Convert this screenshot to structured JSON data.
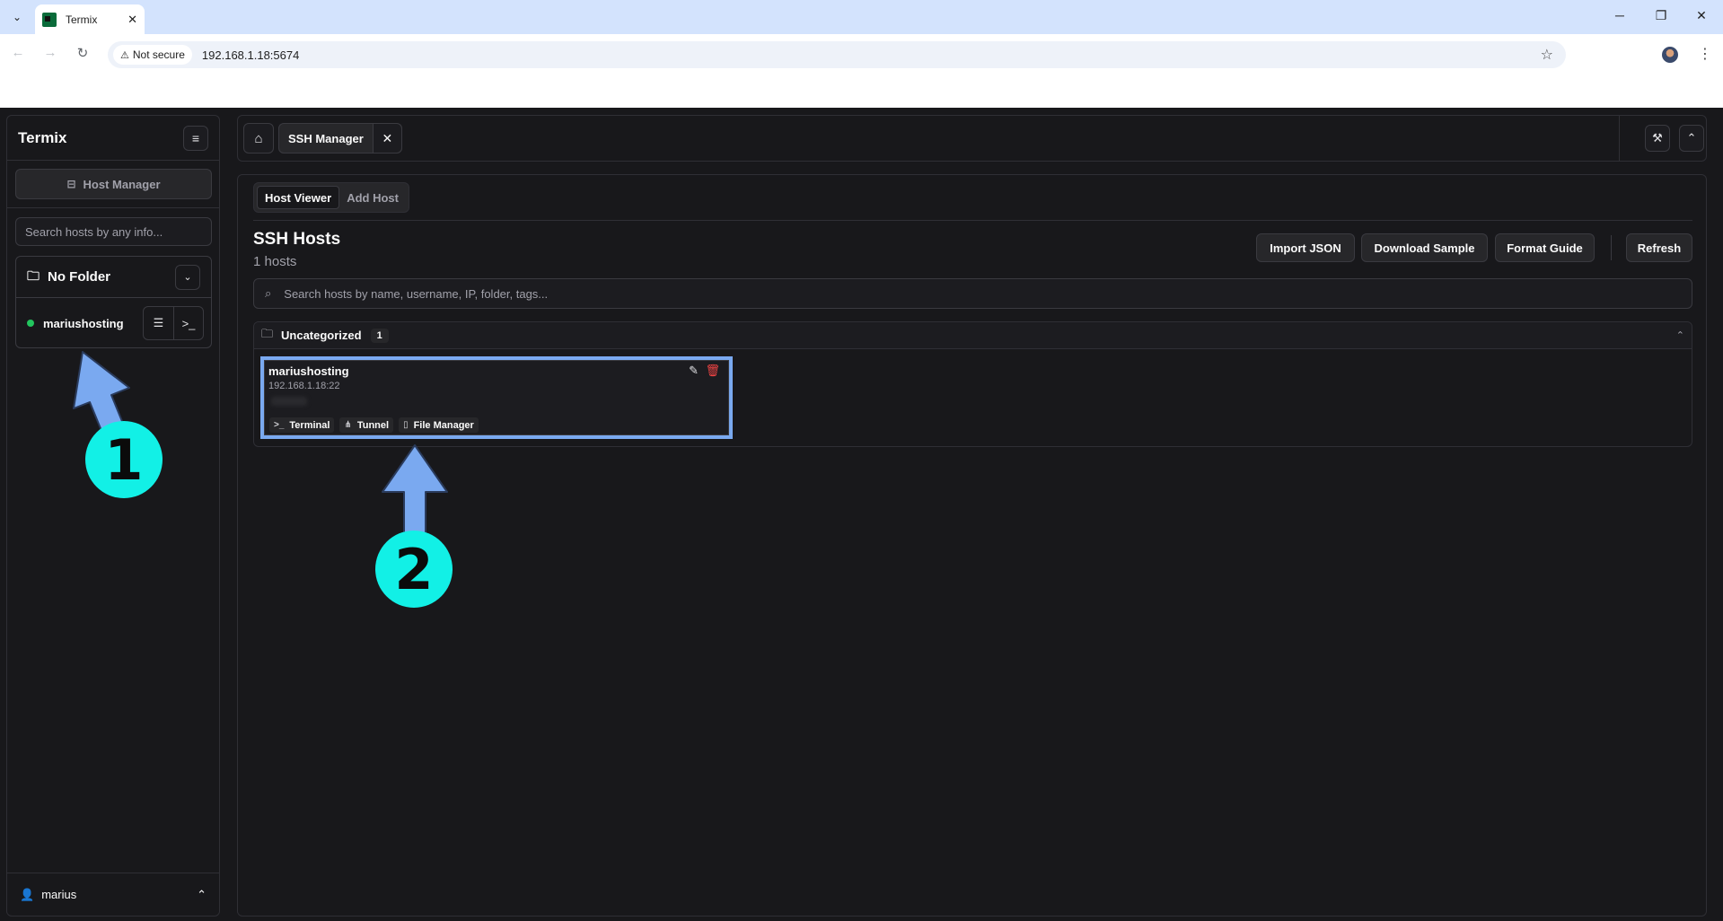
{
  "browser": {
    "tab_title": "Termix",
    "security_label": "Not secure",
    "url": "192.168.1.18:5674"
  },
  "sidebar": {
    "title": "Termix",
    "host_manager_label": "Host Manager",
    "search_placeholder": "Search hosts by any info...",
    "folder_name": "No Folder",
    "hosts": [
      {
        "name": "mariushosting",
        "status": "online",
        "status_color": "#22c55e"
      }
    ],
    "user_name": "marius"
  },
  "topbar": {
    "tab_label": "SSH Manager"
  },
  "main": {
    "subtabs": [
      "Host Viewer",
      "Add Host"
    ],
    "active_subtab": "Host Viewer",
    "title": "SSH Hosts",
    "subtitle": "1 hosts",
    "actions": [
      "Import JSON",
      "Download Sample",
      "Format Guide",
      "Refresh"
    ],
    "search_placeholder": "Search hosts by name, username, IP, folder, tags...",
    "group": {
      "name": "Uncategorized",
      "count": "1",
      "host": {
        "name": "mariushosting",
        "address": "192.168.1.18:22",
        "chips": [
          "Terminal",
          "Tunnel",
          "File Manager"
        ]
      }
    }
  },
  "annotations": {
    "step1": "1",
    "step2": "2",
    "badge_color": "#12f0e6",
    "arrow_color": "#7aa9f0",
    "highlight_color": "#7aa9f0"
  }
}
